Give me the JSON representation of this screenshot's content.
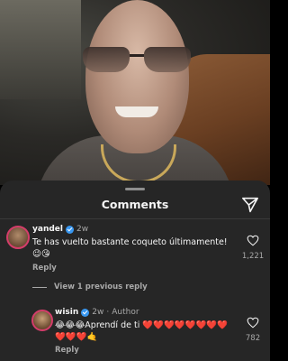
{
  "sheet": {
    "title": "Comments"
  },
  "comments": [
    {
      "username": "yandel",
      "time": "2w",
      "text": "Te has vuelto bastante coqueto últimamente! 😉😘",
      "reply_label": "Reply",
      "likes": "1,221"
    }
  ],
  "thread": {
    "view_previous": "View 1 previous reply"
  },
  "replies": [
    {
      "username": "wisin",
      "time": "2w",
      "separator": "·",
      "author_tag": "Author",
      "text": "😂😂😂Aprendí de ti ❤️❤️❤️❤️❤️❤️❤️❤️❤️❤️❤️🤙",
      "reply_label": "Reply",
      "likes": "782"
    }
  ],
  "colors": {
    "sheet_bg": "#262626",
    "verified": "#3897f0",
    "muted_text": "#a8a8a8"
  },
  "icons": [
    "share-icon",
    "heart-icon",
    "verified-badge-icon"
  ]
}
